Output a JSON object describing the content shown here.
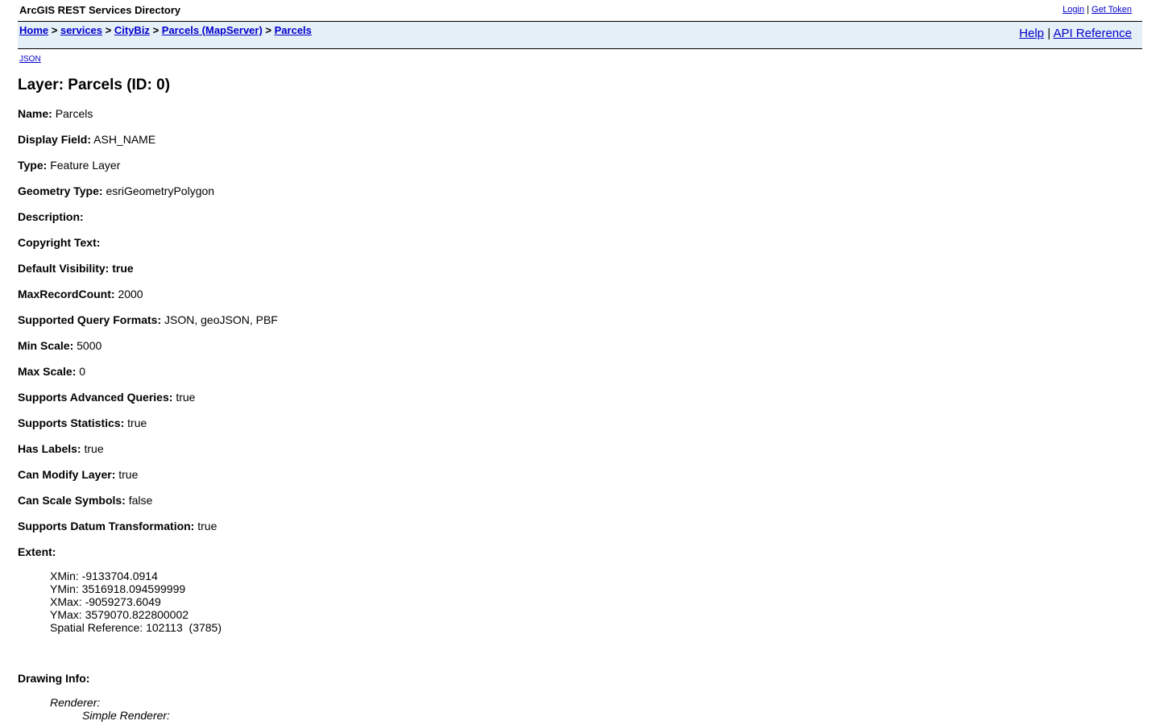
{
  "header": {
    "app_title": "ArcGIS REST Services Directory",
    "login_label": "Login",
    "separator": "|",
    "get_token_label": "Get Token"
  },
  "nav": {
    "breadcrumb": [
      {
        "label": "Home"
      },
      {
        "label": "services"
      },
      {
        "label": "CityBiz"
      },
      {
        "label": "Parcels (MapServer)"
      },
      {
        "label": "Parcels"
      }
    ],
    "crumb_sep": ">",
    "help_label": "Help",
    "help_sep": "|",
    "api_reference_label": "API Reference"
  },
  "json_link": "JSON",
  "page_title": "Layer: Parcels (ID: 0)",
  "properties": [
    {
      "label": "Name:",
      "value": "Parcels"
    },
    {
      "label": "Display Field:",
      "value": "ASH_NAME"
    },
    {
      "label": "Type:",
      "value": "Feature Layer"
    },
    {
      "label": "Geometry Type:",
      "value": "esriGeometryPolygon"
    },
    {
      "label": "Description:",
      "value": ""
    },
    {
      "label": "Copyright Text:",
      "value": ""
    },
    {
      "label": "Default Visibility:",
      "value": "true",
      "value_bold": true
    },
    {
      "label": "MaxRecordCount:",
      "value": "2000"
    },
    {
      "label": "Supported Query Formats:",
      "value": "JSON, geoJSON, PBF"
    },
    {
      "label": "Min Scale:",
      "value": "5000"
    },
    {
      "label": "Max Scale:",
      "value": "0"
    },
    {
      "label": "Supports Advanced Queries:",
      "value": "true"
    },
    {
      "label": "Supports Statistics:",
      "value": "true"
    },
    {
      "label": "Has Labels:",
      "value": "true"
    },
    {
      "label": "Can Modify Layer:",
      "value": "true"
    },
    {
      "label": "Can Scale Symbols:",
      "value": "false"
    },
    {
      "label": "Supports Datum Transformation:",
      "value": "true"
    },
    {
      "label": "Extent:",
      "value": ""
    }
  ],
  "extent": {
    "xmin": "XMin: -9133704.0914",
    "ymin": "YMin: 3516918.094599999",
    "xmax": "XMax: -9059273.6049",
    "ymax": "YMax: 3579070.822800002",
    "spatial_reference": "Spatial Reference: 102113  (3785)"
  },
  "drawing_info": {
    "label": "Drawing Info:",
    "renderer_label": "Renderer:",
    "simple_renderer_label": "Simple Renderer:"
  }
}
